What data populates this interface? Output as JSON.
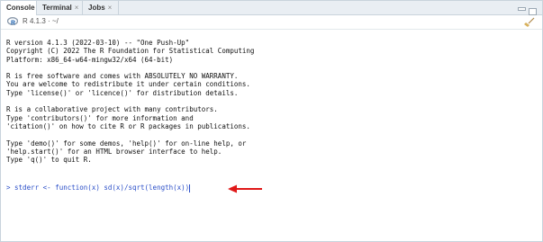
{
  "tabs": [
    {
      "label": "Console",
      "closable": false,
      "active": true
    },
    {
      "label": "Terminal",
      "closable": true,
      "active": false
    },
    {
      "label": "Jobs",
      "closable": true,
      "active": false
    }
  ],
  "tab_close_glyph": "×",
  "subbar": {
    "version": "R 4.1.3 · ~/"
  },
  "console": {
    "output_lines": [
      "R version 4.1.3 (2022-03-10) -- \"One Push-Up\"",
      "Copyright (C) 2022 The R Foundation for Statistical Computing",
      "Platform: x86_64-w64-mingw32/x64 (64-bit)",
      "",
      "R is free software and comes with ABSOLUTELY NO WARRANTY.",
      "You are welcome to redistribute it under certain conditions.",
      "Type 'license()' or 'licence()' for distribution details.",
      "",
      "R is a collaborative project with many contributors.",
      "Type 'contributors()' for more information and",
      "'citation()' on how to cite R or R packages in publications.",
      "",
      "Type 'demo()' for some demos, 'help()' for on-line help, or",
      "'help.start()' for an HTML browser interface to help.",
      "Type 'q()' to quit R."
    ],
    "prompt": ">",
    "input": "stderr <- function(x) sd(x)/sqrt(length(x))"
  },
  "colors": {
    "prompt": "#2a4ec8",
    "arrow": "#e01818",
    "tabbar": "#e9eef3"
  },
  "icons": {
    "r_logo": "r-logo-icon",
    "clear": "broom-icon",
    "arrow": "red-arrow-icon"
  }
}
